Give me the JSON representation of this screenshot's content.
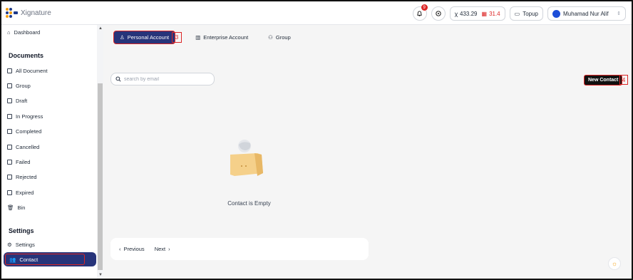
{
  "app": {
    "logo_text": "Xignature"
  },
  "header": {
    "notification_count": "9",
    "coin_a": "433.29",
    "coin_b": "31.4",
    "topup_label": "Topup",
    "user_name": "Muhamad Nur Alif"
  },
  "sidebar": {
    "dashboard": "Dashboard",
    "documents_heading": "Documents",
    "items": [
      "All Document",
      "Group",
      "Draft",
      "In Progress",
      "Completed",
      "Cancelled",
      "Failed",
      "Rejected",
      "Expired",
      "Bin"
    ],
    "settings_heading": "Settings",
    "settings_item": "Settings",
    "contact_item": "Contact"
  },
  "tabs": [
    "Personal Account",
    "Enterprise Account",
    "Group"
  ],
  "annotations": {
    "tab_marker": "3",
    "new_contact_marker": "4"
  },
  "search": {
    "placeholder": "search by email"
  },
  "new_contact_label": "New Contact",
  "empty_message": "Contact is Empty",
  "pager": {
    "previous": "Previous",
    "next": "Next"
  },
  "colors": {
    "primary": "#27347a",
    "highlight": "#dc2626",
    "badge": "#dc2626"
  }
}
